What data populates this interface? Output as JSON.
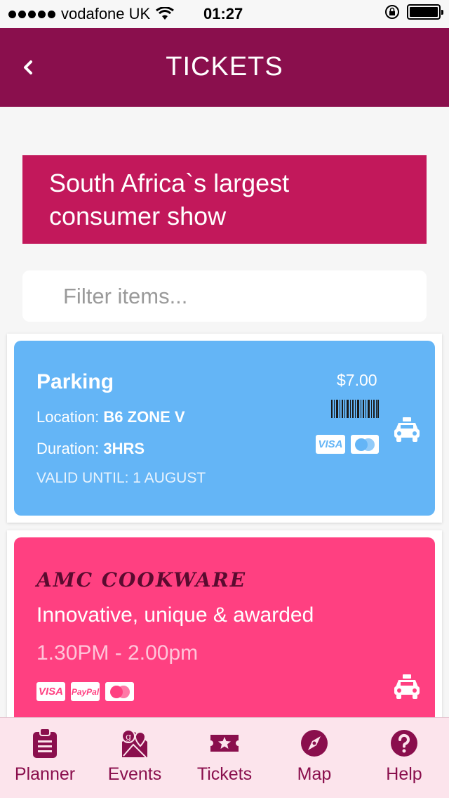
{
  "status_bar": {
    "carrier": "vodafone UK",
    "time": "01:27"
  },
  "header": {
    "title": "TICKETS"
  },
  "banner": {
    "line1": "South Africa`s largest",
    "line2": "consumer show"
  },
  "filter": {
    "placeholder": "Filter items...",
    "value": ""
  },
  "tickets": [
    {
      "name": "Parking",
      "location_label": "Location:",
      "location_value": "B6 ZONE V",
      "duration_label": "Duration:",
      "duration_value": "3HRS",
      "valid": "VALID UNTIL: 1 AUGUST",
      "price": "$7.00",
      "payments": [
        "VISA",
        "MasterCard"
      ],
      "color": "#64b5f6"
    },
    {
      "name": "AMC COOKWARE",
      "tagline": "Innovative, unique & awarded",
      "time": "1.30PM - 2.00pm",
      "payments": [
        "VISA",
        "PayPal",
        "MasterCard"
      ],
      "color": "#ff4081"
    }
  ],
  "tabs": [
    {
      "label": "Planner",
      "icon": "clipboard-icon"
    },
    {
      "label": "Events",
      "icon": "map-pin-icon"
    },
    {
      "label": "Tickets",
      "icon": "ticket-star-icon"
    },
    {
      "label": "Map",
      "icon": "compass-icon"
    },
    {
      "label": "Help",
      "icon": "help-icon"
    }
  ],
  "colors": {
    "header": "#8a0f4d",
    "banner": "#c2185b",
    "tab_bg": "#fce4ec"
  }
}
